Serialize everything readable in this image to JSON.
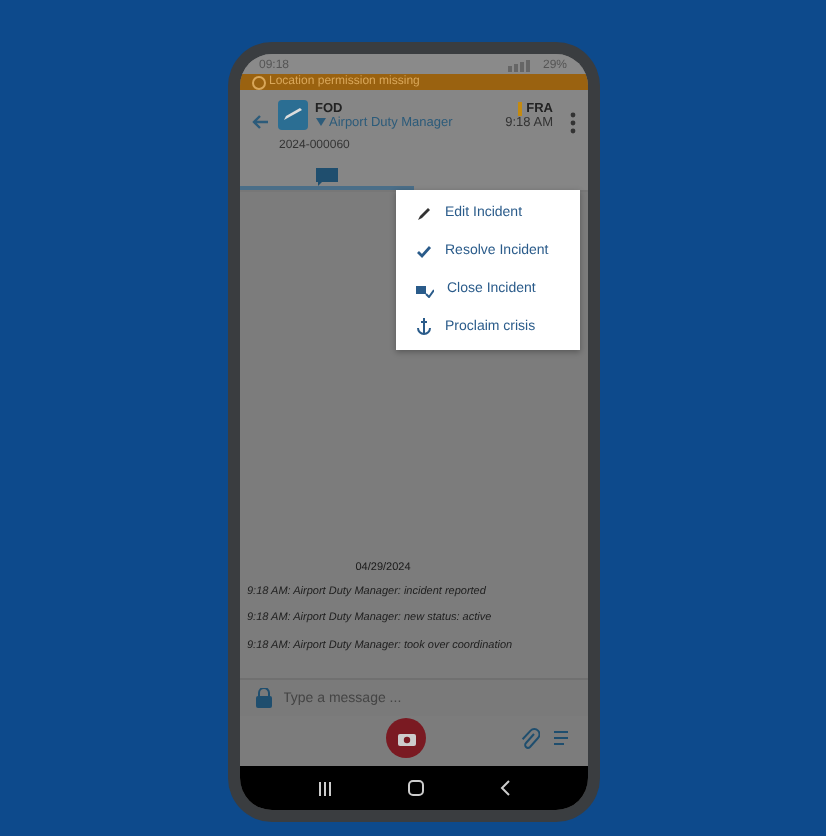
{
  "status_bar": {
    "time": "09:18",
    "battery": "29%"
  },
  "banner": {
    "text": "Location permission missing"
  },
  "header": {
    "title": "FOD",
    "airport": "FRA",
    "role": "Airport Duty Manager",
    "time": "9:18 AM",
    "incident_number": "2024-000060"
  },
  "tabs": [
    {
      "selected": true
    }
  ],
  "menu": [
    {
      "kind": "edit",
      "label": "Edit Incident"
    },
    {
      "kind": "resolve",
      "label": "Resolve Incident"
    },
    {
      "kind": "close",
      "label": "Close Incident"
    },
    {
      "kind": "crisis",
      "label": "Proclaim crisis"
    }
  ],
  "log": {
    "date": "04/29/2024",
    "entries": [
      "9:18 AM: Airport Duty Manager: incident reported",
      "9:18 AM: Airport Duty Manager: new status: active",
      "9:18 AM: Airport Duty Manager: took over coordination"
    ]
  },
  "composer": {
    "placeholder": "Type a message ..."
  }
}
